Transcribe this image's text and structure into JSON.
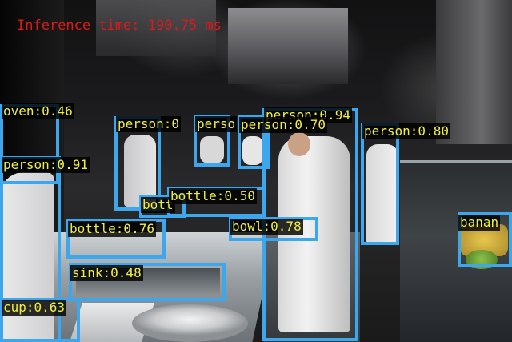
{
  "inference_text": "Inference time: 190.75 ms",
  "colors": {
    "box": "#3da7ee",
    "label_text": "#f2ef3c",
    "label_bg": "#000000",
    "inference_text": "#e01818"
  },
  "detections": [
    {
      "label": "oven:0.46"
    },
    {
      "label": "person:0.91"
    },
    {
      "label": "person:0"
    },
    {
      "label": "perso"
    },
    {
      "label": "person:0.70"
    },
    {
      "label": "person:0.94"
    },
    {
      "label": "person:0.80"
    },
    {
      "label": "bott"
    },
    {
      "label": "bottle:0.50"
    },
    {
      "label": "bottle:0.76"
    },
    {
      "label": "bowl:0.78"
    },
    {
      "label": "banan"
    },
    {
      "label": "sink:0.48"
    },
    {
      "label": "cup:0.63"
    }
  ]
}
